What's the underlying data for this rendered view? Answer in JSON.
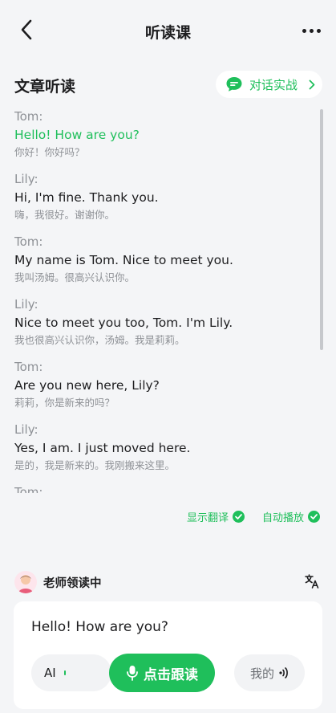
{
  "header": {
    "title": "听读课",
    "back_icon": "chevron-left-icon",
    "more_icon": "more-horizontal-icon"
  },
  "section": {
    "title": "文章听读",
    "dialog_practice_label": "对话实战",
    "dialog_icon": "chat-bubble-icon"
  },
  "dialogue": [
    {
      "speaker": "Tom:",
      "en": "Hello! How are you?",
      "zh": "你好！你好吗？",
      "active": true
    },
    {
      "speaker": "Lily:",
      "en": "Hi, I'm fine. Thank you.",
      "zh": "嗨，我很好。谢谢你。",
      "active": false
    },
    {
      "speaker": "Tom:",
      "en": "My name is Tom. Nice to meet you.",
      "zh": "我叫汤姆。很高兴认识你。",
      "active": false
    },
    {
      "speaker": "Lily:",
      "en": "Nice to meet you too, Tom. I'm Lily.",
      "zh": "我也很高兴认识你，汤姆。我是莉莉。",
      "active": false
    },
    {
      "speaker": "Tom:",
      "en": "Are you new here, Lily?",
      "zh": "莉莉，你是新来的吗？",
      "active": false
    },
    {
      "speaker": "Lily:",
      "en": "Yes, I am. I just moved here.",
      "zh": "是的，我是新来的。我刚搬来这里。",
      "active": false
    },
    {
      "speaker": "Tom:",
      "en": "",
      "zh": "",
      "active": false
    }
  ],
  "toggles": {
    "show_translation": "显示翻译",
    "auto_play": "自动播放",
    "show_translation_checked": true,
    "auto_play_checked": true
  },
  "teacher": {
    "label": "老师领读中",
    "translate_icon": "translate-icon"
  },
  "practice": {
    "sentence": "Hello! How are you?",
    "ai_label": "AI",
    "record_label": "点击跟读",
    "mine_label": "我的"
  },
  "colors": {
    "accent": "#1fbf5b",
    "background": "#f4f5f7",
    "muted_text": "#8e9196"
  }
}
